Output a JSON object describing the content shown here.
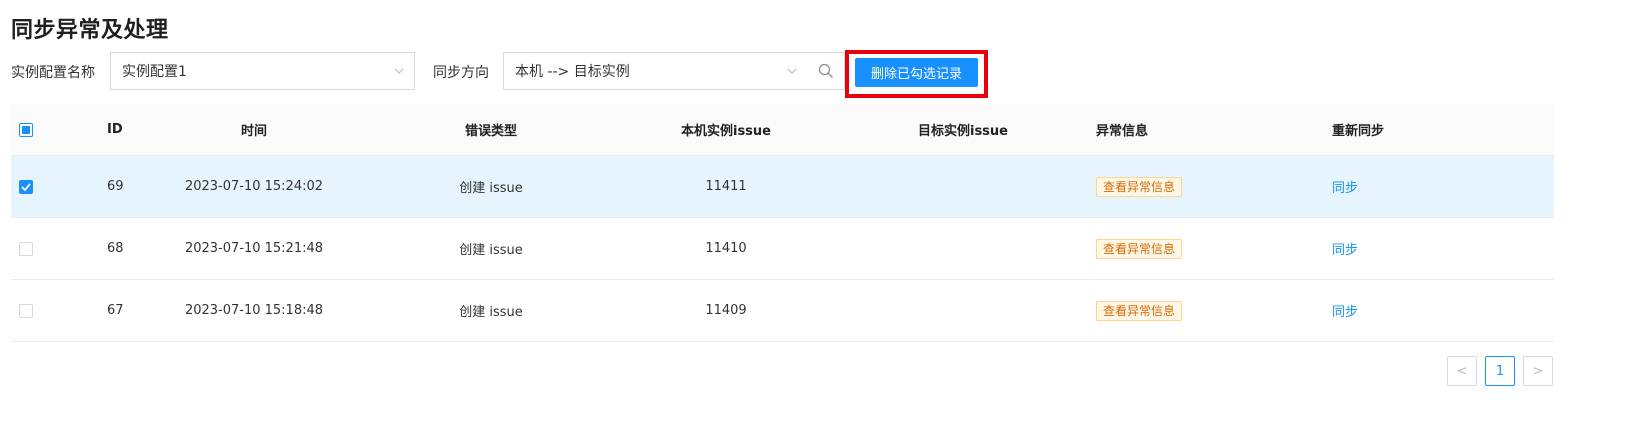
{
  "title": "同步异常及处理",
  "filters": {
    "instance_label": "实例配置名称",
    "instance_value": "实例配置1",
    "direction_label": "同步方向",
    "direction_value": "本机 --> 目标实例",
    "delete_button": "删除已勾选记录"
  },
  "table": {
    "headers": [
      "ID",
      "时间",
      "错误类型",
      "本机实例issue",
      "目标实例issue",
      "异常信息",
      "重新同步"
    ],
    "rows": [
      {
        "id": "69",
        "time": "2023-07-10 15:24:02",
        "error_type": "创建 issue",
        "local_issue": "11411",
        "target_issue": "",
        "error_tag": "查看异常信息",
        "action": "同步",
        "checked": true
      },
      {
        "id": "68",
        "time": "2023-07-10 15:21:48",
        "error_type": "创建 issue",
        "local_issue": "11410",
        "target_issue": "",
        "error_tag": "查看异常信息",
        "action": "同步",
        "checked": false
      },
      {
        "id": "67",
        "time": "2023-07-10 15:18:48",
        "error_type": "创建 issue",
        "local_issue": "11409",
        "target_issue": "",
        "error_tag": "查看异常信息",
        "action": "同步",
        "checked": false
      }
    ]
  },
  "pagination": {
    "prev": "<",
    "current": "1",
    "next": ">"
  },
  "colors": {
    "primary": "#1890ff",
    "highlight": "#e8000b",
    "tag_text": "#d46b08",
    "selected_row": "#e6f4fd"
  }
}
